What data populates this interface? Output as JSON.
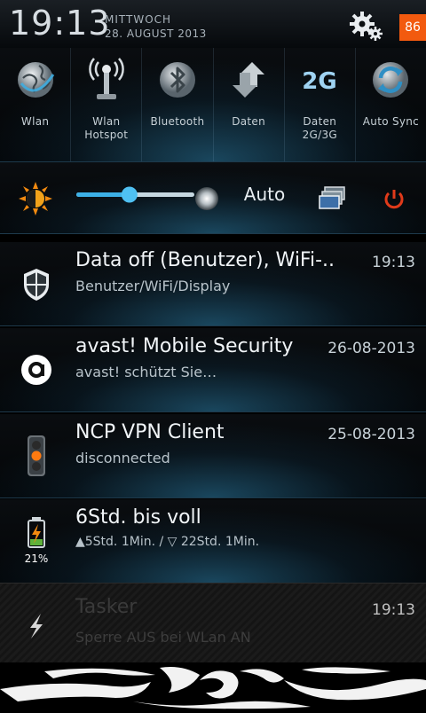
{
  "status": {
    "time": "19:13",
    "day_name": "MITTWOCH",
    "date": "28. AUGUST 2013",
    "battery_level": "86",
    "battery_color": "#f25a0f"
  },
  "toggles": [
    {
      "label": "Wlan",
      "icon": "globe-icon"
    },
    {
      "label": "Wlan\nHotspot",
      "icon": "hotspot-antenna-icon"
    },
    {
      "label": "Bluetooth",
      "icon": "bluetooth-icon"
    },
    {
      "label": "Daten",
      "icon": "data-arrows-icon"
    },
    {
      "label": "Daten\n2G/3G",
      "icon": "2g-icon",
      "icon_text": "2G"
    },
    {
      "label": "Auto Sync",
      "icon": "sync-icon"
    }
  ],
  "brightness": {
    "auto_label": "Auto",
    "level": 0.45
  },
  "notifications": [
    {
      "title": "Data off (Benutzer), WiFi-..",
      "time": "19:13",
      "text": "Benutzer/WiFi/Display",
      "icon": "shield-icon"
    },
    {
      "title": "avast! Mobile Security",
      "time": "26-08-2013",
      "text": "avast! schützt Sie…",
      "icon": "avast-icon"
    },
    {
      "title": "NCP VPN Client",
      "time": "25-08-2013",
      "text": "disconnected",
      "icon": "traffic-light-icon"
    },
    {
      "title": "6Std. bis voll",
      "time": "",
      "text": "▲5Std. 1Min.  / ▽ 22Std. 1Min.",
      "icon": "battery-charging-icon",
      "extra": "21%"
    },
    {
      "title": "Tasker",
      "time": "19:13",
      "text": "Sperre AUS bei WLan AN",
      "icon": "tasker-bolt-icon"
    }
  ],
  "colors": {
    "accent_blue": "#3cb0e6",
    "battery_orange": "#f25a0f"
  }
}
